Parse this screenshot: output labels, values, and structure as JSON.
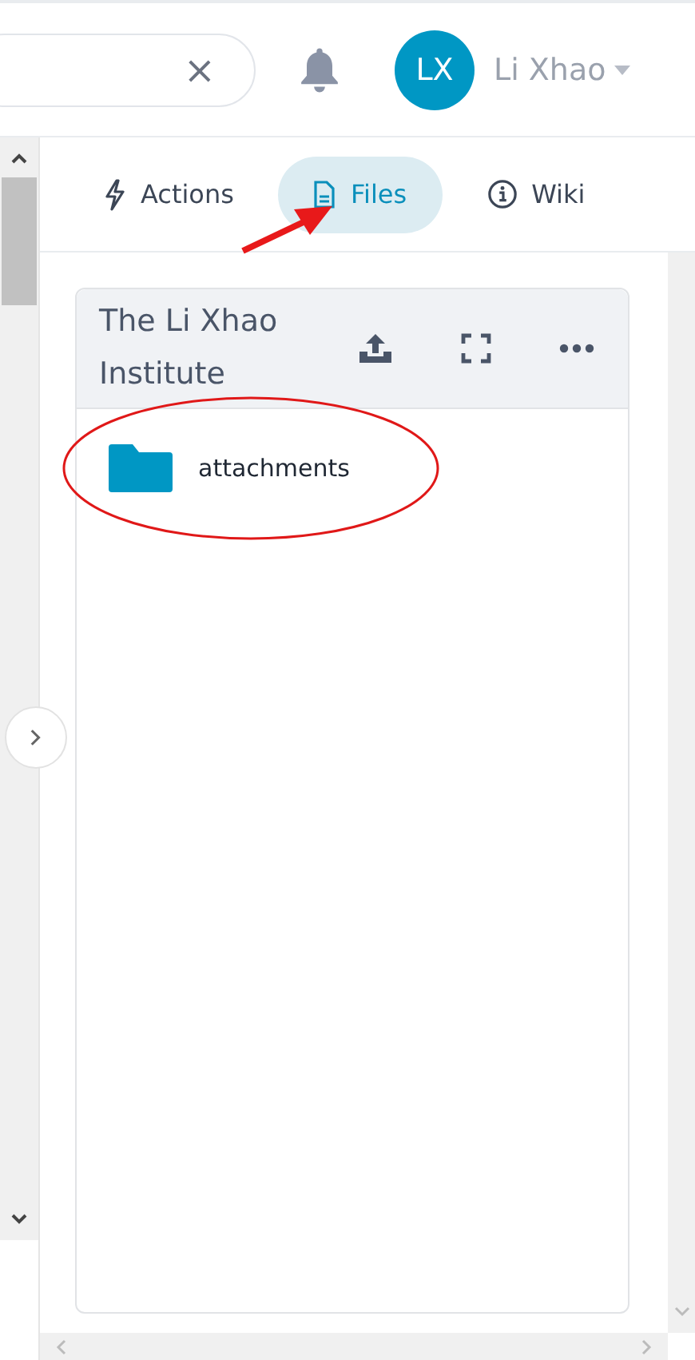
{
  "header": {
    "search": {
      "clear": "×"
    },
    "user": {
      "initials": "LX",
      "name": "Li Xhao"
    }
  },
  "tabs": [
    {
      "label": "Actions",
      "selected": false
    },
    {
      "label": "Files",
      "selected": true
    },
    {
      "label": "Wiki",
      "selected": false
    }
  ],
  "files_card": {
    "title": "The Li Xhao Institute",
    "items": [
      {
        "name": "attachments",
        "kind": "folder"
      }
    ]
  },
  "annotations": [
    {
      "kind": "arrow"
    },
    {
      "kind": "ellipse"
    }
  ]
}
